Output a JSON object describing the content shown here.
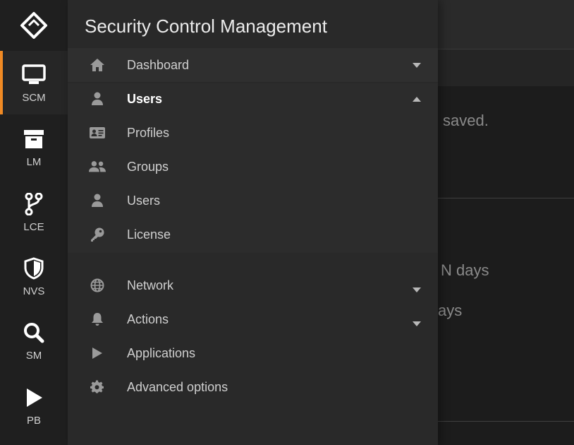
{
  "app": {
    "title": "Security Control Management"
  },
  "rail": {
    "items": [
      {
        "id": "scm",
        "label": "SCM",
        "icon": "monitor-icon",
        "active": true
      },
      {
        "id": "lm",
        "label": "LM",
        "icon": "archive-icon",
        "active": false
      },
      {
        "id": "lce",
        "label": "LCE",
        "icon": "branch-icon",
        "active": false
      },
      {
        "id": "nvs",
        "label": "NVS",
        "icon": "shield-icon",
        "active": false
      },
      {
        "id": "sm",
        "label": "SM",
        "icon": "search-icon",
        "active": false
      },
      {
        "id": "pb",
        "label": "PB",
        "icon": "play-icon",
        "active": false
      }
    ]
  },
  "drawer": {
    "items": [
      {
        "label": "Dashboard",
        "icon": "home-icon",
        "chevron": "down"
      },
      {
        "label": "Users",
        "icon": "user-icon",
        "chevron": "up",
        "bold": true
      },
      {
        "label": "Profiles",
        "icon": "id-card-icon"
      },
      {
        "label": "Groups",
        "icon": "group-icon"
      },
      {
        "label": "Users",
        "icon": "user-icon"
      },
      {
        "label": "License",
        "icon": "key-icon"
      },
      {
        "label": "Network",
        "icon": "globe-icon",
        "chevron": "down"
      },
      {
        "label": "Actions",
        "icon": "bell-icon",
        "chevron": "down"
      },
      {
        "label": "Applications",
        "icon": "play-icon"
      },
      {
        "label": "Advanced options",
        "icon": "gear-icon"
      }
    ]
  },
  "background": {
    "text1": "saved.",
    "text2": "N days",
    "text3": "ays"
  },
  "colors": {
    "accent": "#f08a24",
    "drawer": "#292929",
    "rail": "#1f1f1f"
  }
}
